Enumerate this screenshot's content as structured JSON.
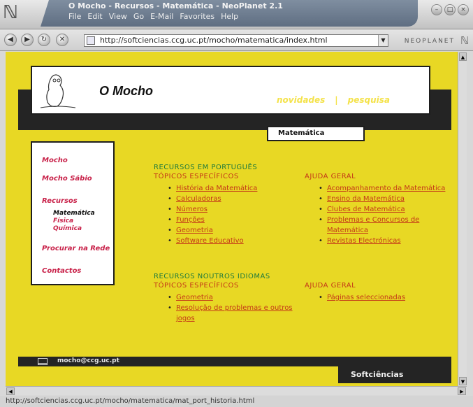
{
  "window": {
    "title": "O Mocho - Recursos - Matemática - NeoPlanet 2.1",
    "menu": [
      "File",
      "Edit",
      "View",
      "Go",
      "E-Mail",
      "Favorites",
      "Help"
    ],
    "brand": "NEOPLANET",
    "url": "http://softciencias.ccg.uc.pt/mocho/matematica/index.html",
    "status": "http://softciencias.ccg.uc.pt/mocho/matematica/mat_port_historia.html"
  },
  "page": {
    "site_title": "O Mocho",
    "top_links": [
      "novidades",
      "pesquisa"
    ],
    "section_tab": "Matemática",
    "sidebar": {
      "items": [
        "Mocho",
        "Mocho Sábio",
        "Recursos",
        "Procurar na Rede",
        "Contactos"
      ],
      "sub_items": [
        "Matemática",
        "Física",
        "Química"
      ]
    },
    "pt": {
      "title": "RECURSOS EM PORTUGUÊS",
      "topics_heading": "TÓPICOS ESPECÍFICOS",
      "topics": [
        "História da Matemática",
        "Calculadoras",
        "Números",
        "Funções",
        "Geometria",
        "Software Educativo"
      ],
      "general_heading": "AJUDA GERAL",
      "general": [
        "Acompanhamento da Matemática",
        "Ensino da Matemática",
        "Clubes de Matemática",
        "Problemas e Concursos de Matemática",
        "Revistas Electrónicas"
      ]
    },
    "other": {
      "title": "RECURSOS NOUTROS IDIOMAS",
      "topics_heading": "TÓPICOS ESPECÍFICOS",
      "topics": [
        "Geometria",
        "Resolução de problemas e outros jogos"
      ],
      "general_heading": "AJUDA GERAL",
      "general": [
        "Páginas seleccionadas"
      ]
    },
    "footer": {
      "email": "mocho@ccg.uc.pt",
      "brand": "Softciências"
    }
  },
  "colors": {
    "page_background": "#e8d824",
    "dark": "#242424",
    "link": "#c43818",
    "heading_green": "#1f7a3c",
    "sidebar_link": "#c82048"
  }
}
